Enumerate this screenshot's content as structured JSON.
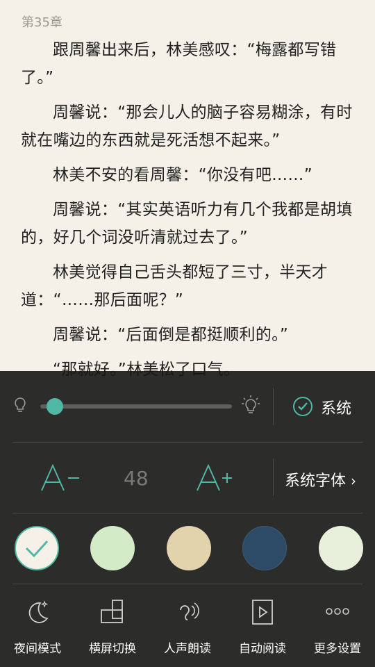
{
  "chapter": {
    "title": "第35章"
  },
  "paragraphs": [
    "跟周馨出来后，林美感叹：“梅露都写错了。”",
    "周馨说：“那会儿人的脑子容易糊涂，有时就在嘴边的东西就是死活想不起来。”",
    "林美不安的看周馨：“你没有吧……”",
    "周馨说：“其实英语听力有几个我都是胡填的，好几个词没听清就过去了。”",
    "林美觉得自己舌头都短了三寸，半天才道：“……那后面呢？”",
    "周馨说：“后面倒是都挺顺利的。”",
    "“那就好。”林美松了口气。"
  ],
  "settings": {
    "brightness": {
      "level": 0.08,
      "system_label": "系统",
      "system_checked": true
    },
    "font": {
      "decrease_label": "A-",
      "size": "48",
      "increase_label": "A+",
      "font_link": "系统字体"
    },
    "themes": [
      {
        "color": "#f5f1e8",
        "selected": true
      },
      {
        "color": "#d3ebc7",
        "selected": false
      },
      {
        "color": "#e3d3ac",
        "selected": false
      },
      {
        "color": "#2d4a66",
        "selected": false
      },
      {
        "color": "#e8f0dc",
        "selected": false
      }
    ],
    "accent": "#4fb7a3"
  },
  "toolbar": [
    {
      "icon": "moon-icon",
      "label": "夜间模式"
    },
    {
      "icon": "rotate-screen-icon",
      "label": "横屏切换"
    },
    {
      "icon": "voice-read-icon",
      "label": "人声朗读"
    },
    {
      "icon": "auto-read-icon",
      "label": "自动阅读"
    },
    {
      "icon": "more-icon",
      "label": "更多设置"
    }
  ]
}
